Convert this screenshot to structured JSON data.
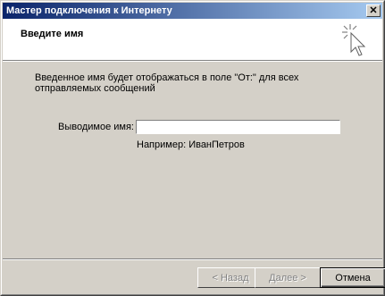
{
  "window": {
    "title": "Мастер подключения к Интернету",
    "close_glyph": "✕"
  },
  "header": {
    "title": "Введите имя",
    "icon": "wizard-cursor-icon"
  },
  "description": "Введенное имя будет отображаться в поле \"От:\" для всех отправляемых сообщений",
  "form": {
    "display_name_label": "Выводимое имя:",
    "display_name_value": "",
    "example": "Например: ИванПетров"
  },
  "buttons": {
    "back": "< Назад",
    "next": "Далее >",
    "cancel": "Отмена"
  },
  "colors": {
    "titlebar_start": "#0a246a",
    "titlebar_end": "#a6caf0",
    "dialog_bg": "#d4d0c8"
  }
}
